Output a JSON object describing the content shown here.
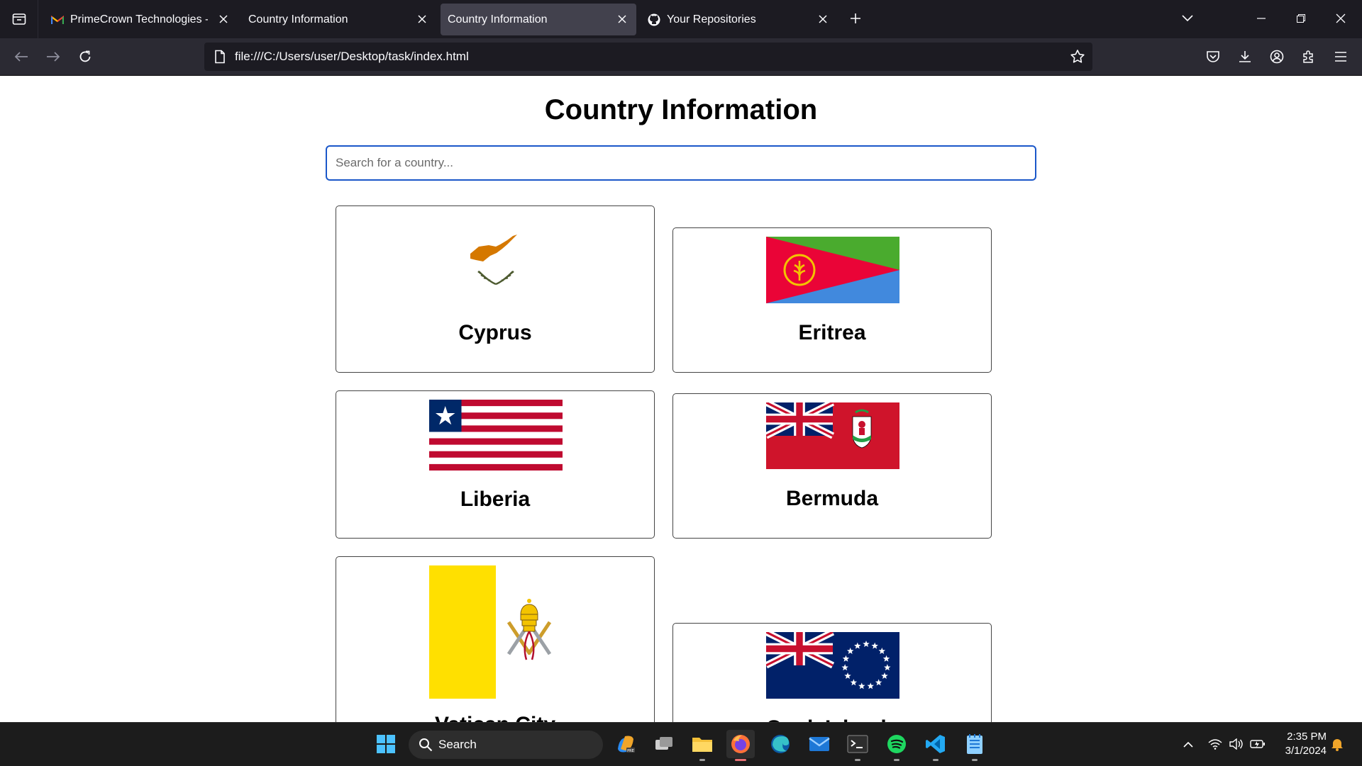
{
  "browser": {
    "tabs": [
      {
        "title": "PrimeCrown Technologies - Full",
        "icon": "gmail-icon",
        "active": false
      },
      {
        "title": "Country Information",
        "icon": "none",
        "active": false
      },
      {
        "title": "Country Information",
        "icon": "none",
        "active": true
      },
      {
        "title": "Your Repositories",
        "icon": "github-icon",
        "active": false
      }
    ],
    "url": "file:///C:/Users/user/Desktop/task/index.html"
  },
  "page": {
    "title": "Country Information",
    "search_placeholder": "Search for a country...",
    "countries": [
      {
        "name": "Cyprus",
        "flag": "cyprus-flag"
      },
      {
        "name": "Eritrea",
        "flag": "eritrea-flag"
      },
      {
        "name": "Liberia",
        "flag": "liberia-flag"
      },
      {
        "name": "Bermuda",
        "flag": "bermuda-flag"
      },
      {
        "name": "Vatican City",
        "flag": "vatican-flag"
      },
      {
        "name": "Cook Islands",
        "flag": "cook-islands-flag"
      }
    ]
  },
  "taskbar": {
    "search_label": "Search",
    "time": "2:35 PM",
    "date": "3/1/2024",
    "apps": [
      "windows-start-icon",
      "copilot-icon",
      "task-view-icon",
      "file-explorer-icon",
      "firefox-icon",
      "edge-icon",
      "mail-icon",
      "terminal-icon",
      "spotify-icon",
      "vscode-icon",
      "notepad-icon"
    ]
  },
  "colors": {
    "tabbar_bg": "#1c1b22",
    "navbar_bg": "#2b2a33",
    "active_tab_bg": "#42414d",
    "search_focus_border": "#1a57c9",
    "taskbar_bg": "#1c1c1c"
  }
}
